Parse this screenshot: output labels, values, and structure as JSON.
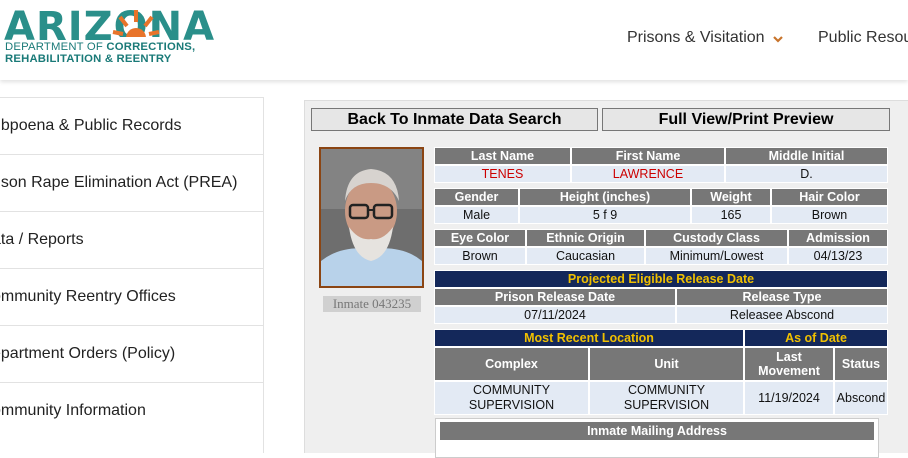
{
  "header": {
    "logo_word": "ARIZONA",
    "logo_line1_a": "DEPARTMENT OF ",
    "logo_line1_b": "CORRECTIONS,",
    "logo_line2": "REHABILITATION & REENTRY",
    "nav": [
      {
        "label": "Prisons & Visitation",
        "icon": "chevron-down-icon"
      },
      {
        "label": "Public Resou"
      }
    ],
    "accent_color": "#2a8f8a",
    "chevron_color": "#c8742c"
  },
  "sidebar": {
    "items": [
      {
        "label": "ubpoena & Public Records"
      },
      {
        "label": "rison Rape Elimination Act (PREA)"
      },
      {
        "label": "ata / Reports"
      },
      {
        "label": "ommunity Reentry Offices"
      },
      {
        "label": "epartment Orders (Policy)"
      },
      {
        "label": "ommunity Information"
      }
    ]
  },
  "content": {
    "back_button": "Back To Inmate Data Search",
    "print_button": "Full View/Print Preview",
    "photo_caption": "Inmate 043235",
    "name_headers": [
      "Last Name",
      "First Name",
      "Middle Initial"
    ],
    "name_values": [
      "TENES",
      "LAWRENCE",
      "D."
    ],
    "physical_headers": [
      "Gender",
      "Height (inches)",
      "Weight",
      "Hair Color"
    ],
    "physical_values": [
      "Male",
      "5 f 9",
      "165",
      "Brown"
    ],
    "origin_headers": [
      "Eye Color",
      "Ethnic Origin",
      "Custody Class",
      "Admission"
    ],
    "origin_values": [
      "Brown",
      "Caucasian",
      "Minimum/Lowest",
      "04/13/23"
    ],
    "release_title": "Projected Eligible Release Date",
    "release_headers": [
      "Prison Release Date",
      "Release Type"
    ],
    "release_values": [
      "07/11/2024",
      "Releasee Abscond"
    ],
    "location_title": "Most Recent Location",
    "as_of_title": "As of Date",
    "location_headers": {
      "complex": "Complex",
      "unit": "Unit",
      "last_movement": "Last Movement",
      "status": "Status"
    },
    "location_values": {
      "complex": "COMMUNITY SUPERVISION",
      "unit": "COMMUNITY SUPERVISION",
      "last_movement": "11/19/2024",
      "status": "Abscond"
    },
    "mailing_title": "Inmate Mailing Address",
    "colors": {
      "header_gray": "#777777",
      "value_blue": "#e3eaf4",
      "navy": "#14285a",
      "gold": "#f0c000",
      "name_red": "#cc0000"
    }
  }
}
